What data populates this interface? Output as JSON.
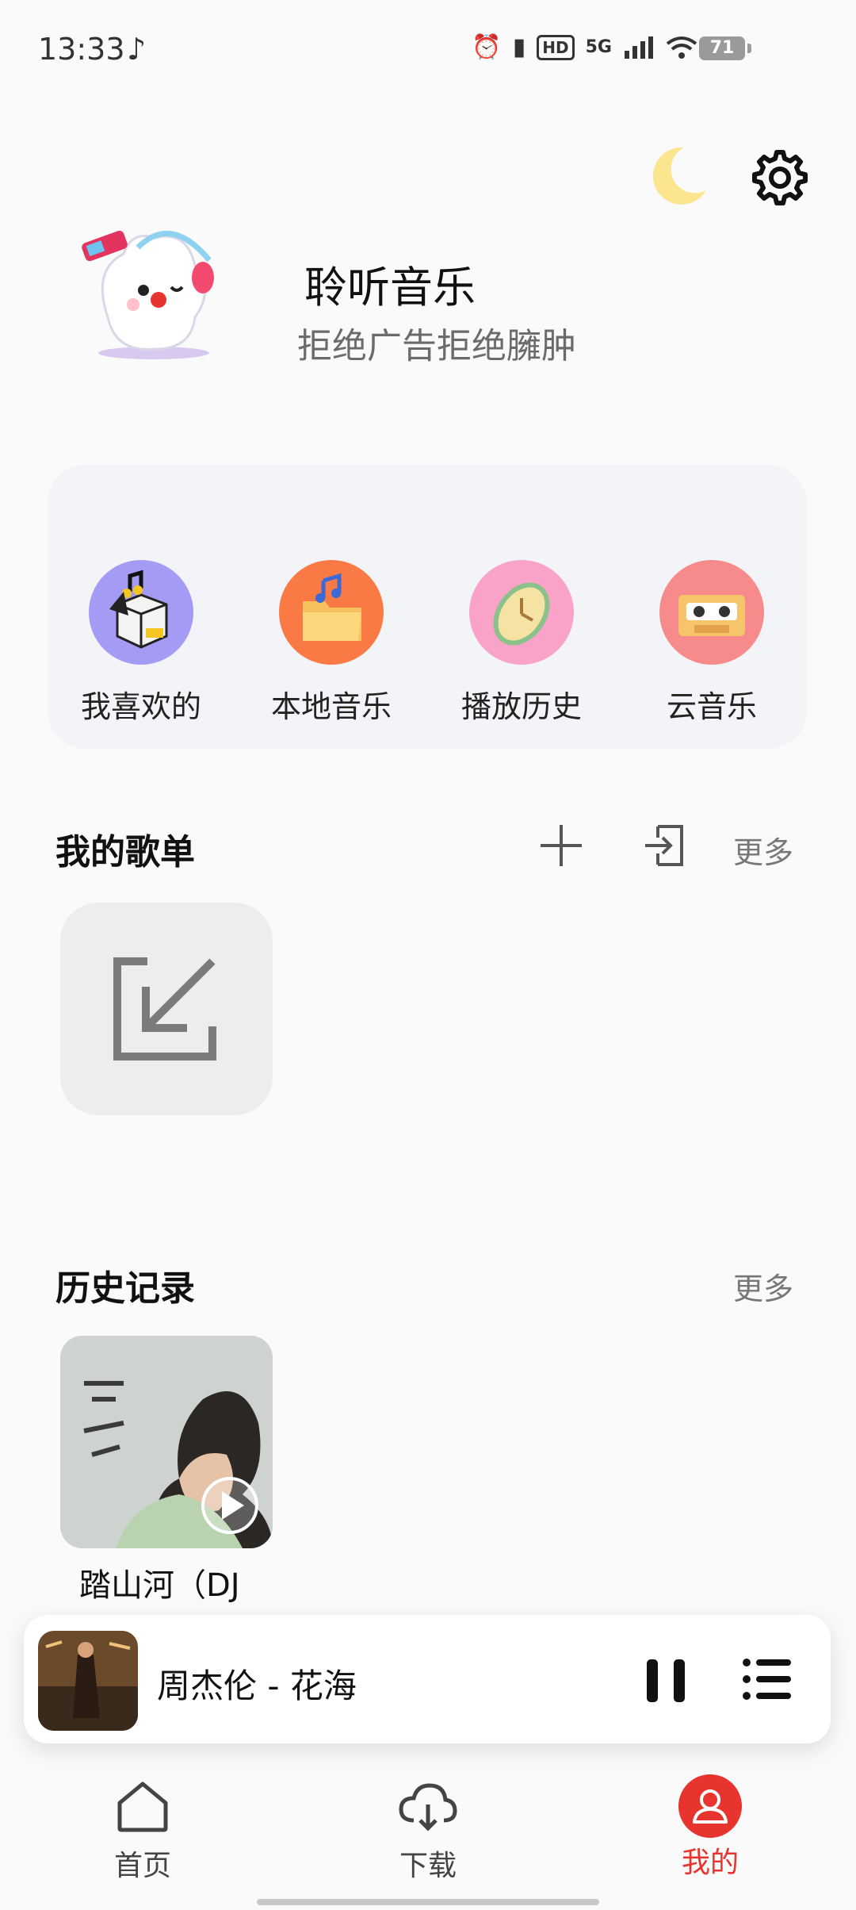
{
  "status_bar": {
    "time": "13:33",
    "note_glyph": "♪",
    "hd_label": "HD",
    "network_label": "5G",
    "battery_level": "71"
  },
  "profile": {
    "title": "聆听音乐",
    "subtitle": "拒绝广告拒绝臃肿"
  },
  "quick_actions": [
    {
      "label": "我喜欢的",
      "icon": "favorites-box-icon",
      "color": "#a49bf5"
    },
    {
      "label": "本地音乐",
      "icon": "folder-music-icon",
      "color": "#f97a45"
    },
    {
      "label": "播放历史",
      "icon": "clock-icon",
      "color": "#f9a3c8"
    },
    {
      "label": "云音乐",
      "icon": "cassette-icon",
      "color": "#f78b8b"
    }
  ],
  "playlists": {
    "title": "我的歌单",
    "more_label": "更多"
  },
  "history": {
    "title": "历史记录",
    "more_label": "更多",
    "items": [
      {
        "title": "踏山河（DJ"
      }
    ]
  },
  "player": {
    "now_playing": "周杰伦 - 花海",
    "state": "playing"
  },
  "bottom_nav": [
    {
      "label": "首页",
      "icon": "home-icon",
      "active": false
    },
    {
      "label": "下载",
      "icon": "cloud-download-icon",
      "active": false
    },
    {
      "label": "我的",
      "icon": "profile-icon",
      "active": true
    }
  ],
  "colors": {
    "accent": "#e8342f",
    "moon": "#fbe58f"
  }
}
